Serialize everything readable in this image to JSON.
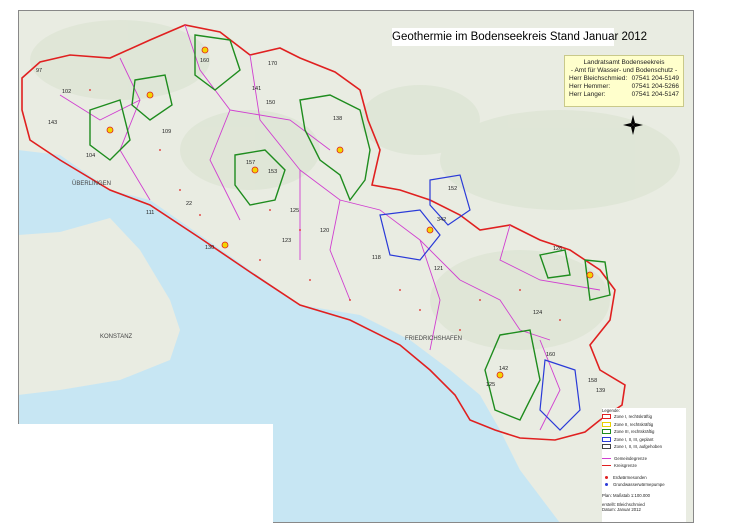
{
  "map": {
    "title": "Geothermie im Bodenseekreis Stand Januar 2012",
    "contact": {
      "office_line1": "Landratsamt Bodenseekreis",
      "office_line2": "- Amt für Wasser- und Bodenschutz -",
      "persons": [
        {
          "name": "Herr Bleichschmied:",
          "phone": "07541 204-5149"
        },
        {
          "name": "Herr Hemmer:",
          "phone": "07541 204-5266"
        },
        {
          "name": "Herr Langer:",
          "phone": "07541 204-5147"
        }
      ]
    },
    "place_labels": [
      "ÜBERLINGEN",
      "KONSTANZ",
      "FRIEDRICHSHAFEN"
    ],
    "zone_numbers": [
      "160",
      "170",
      "150",
      "141",
      "138",
      "157",
      "153",
      "102",
      "109",
      "104",
      "22",
      "130",
      "123",
      "125",
      "120",
      "118",
      "121",
      "152",
      "342",
      "126",
      "160",
      "124",
      "142",
      "125",
      "143",
      "139",
      "158",
      "111",
      "97"
    ],
    "legend": {
      "title": "Legende:",
      "zones": [
        {
          "label": "Zone I, rechtskräftig",
          "color": "#e02020"
        },
        {
          "label": "Zone II, rechtskräftig",
          "color": "#e8d000"
        },
        {
          "label": "Zone III, rechtskräftig",
          "color": "#1e8c1e"
        },
        {
          "label": "Zone I, II, III, geplant",
          "color": "#2a3ad8"
        },
        {
          "label": "Zone I, II, III, aufgehoben",
          "color": "#444444"
        }
      ],
      "boundaries": [
        {
          "label": "Gemeindegrenze",
          "color": "#d040d0"
        },
        {
          "label": "Kreisgrenze",
          "color": "#e02020"
        }
      ],
      "points": [
        {
          "label": "Erdwärmesonden",
          "color": "#e02020"
        },
        {
          "label": "Grundwasserwärmepumpe",
          "color": "#2a3ad8"
        }
      ],
      "scale": "Plan: Maßstab 1:100.000",
      "credit_created": "erstellt:  Bleichschmied",
      "credit_date": "Datum:  Januar 2012"
    }
  }
}
